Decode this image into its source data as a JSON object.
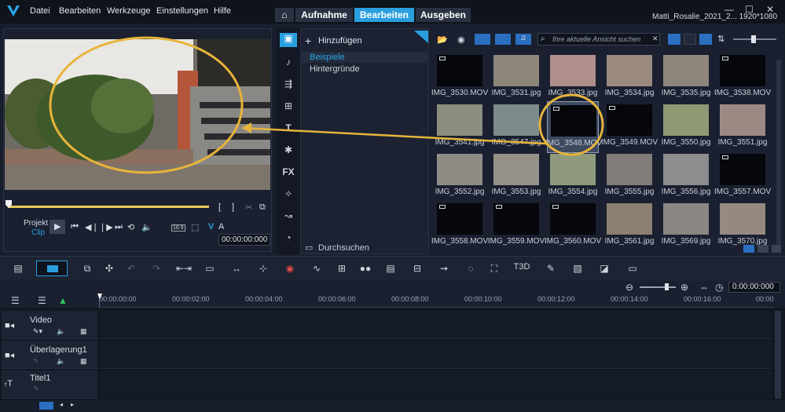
{
  "menu": [
    "Datei",
    "Bearbeiten",
    "Werkzeuge",
    "Einstellungen",
    "Hilfe"
  ],
  "tabs": {
    "aufnahme": "Aufnahme",
    "bearbeiten": "Bearbeiten",
    "ausgeben": "Ausgeben"
  },
  "project_title": "Matti_Rosalie_2021_2... 1920*1080",
  "window_controls": {
    "minimize": "—",
    "maximize": "☐",
    "close": "✕"
  },
  "preview": {
    "projekt": "Projekt",
    "clip": "Clip",
    "aspect": "16:9",
    "timecode": "00:00:00:000",
    "v_label": "V",
    "a_label": "A"
  },
  "library": {
    "add_label": "Hinzufügen",
    "categories": [
      "Beispiele",
      "Hintergründe"
    ],
    "browse": "Durchsuchen",
    "search_placeholder": "Ihre aktuelle Ansicht suchen",
    "fx": "FX",
    "thumbs": [
      {
        "name": "IMG_3530.MOV",
        "kind": "video",
        "color": "#05070b"
      },
      {
        "name": "IMG_3531.jpg",
        "kind": "image",
        "color": "#8d857a"
      },
      {
        "name": "IMG_3533.jpg",
        "kind": "image",
        "color": "#b08e8c"
      },
      {
        "name": "IMG_3534.jpg",
        "kind": "image",
        "color": "#9a8a7e"
      },
      {
        "name": "IMG_3535.jpg",
        "kind": "image",
        "color": "#8e867c"
      },
      {
        "name": "IMG_3538.MOV",
        "kind": "video",
        "color": "#05070b"
      },
      {
        "name": "IMG_3541.jpg",
        "kind": "image",
        "color": "#8a8f7e"
      },
      {
        "name": "IMG_3547.jpg",
        "kind": "image",
        "color": "#7d8c8a"
      },
      {
        "name": "IMG_3548.MOV",
        "kind": "video",
        "color": "#05070b"
      },
      {
        "name": "IMG_3549.MOV",
        "kind": "video",
        "color": "#05070b"
      },
      {
        "name": "IMG_3550.jpg",
        "kind": "image",
        "color": "#8e9a74"
      },
      {
        "name": "IMG_3551.jpg",
        "kind": "image",
        "color": "#9b8a84"
      },
      {
        "name": "IMG_3552.jpg",
        "kind": "image",
        "color": "#8f8c86"
      },
      {
        "name": "IMG_3553.jpg",
        "kind": "image",
        "color": "#979289"
      },
      {
        "name": "IMG_3554.jpg",
        "kind": "image",
        "color": "#8f9a7c"
      },
      {
        "name": "IMG_3555.jpg",
        "kind": "image",
        "color": "#817c7a"
      },
      {
        "name": "IMG_3556.jpg",
        "kind": "image",
        "color": "#8d8c8e"
      },
      {
        "name": "IMG_3557.MOV",
        "kind": "video",
        "color": "#05070b"
      },
      {
        "name": "IMG_3558.MOV",
        "kind": "video",
        "color": "#05070b"
      },
      {
        "name": "IMG_3559.MOV",
        "kind": "video",
        "color": "#05070b"
      },
      {
        "name": "IMG_3560.MOV",
        "kind": "video",
        "color": "#05070b"
      },
      {
        "name": "IMG_3561.jpg",
        "kind": "image",
        "color": "#8c8070"
      },
      {
        "name": "IMG_3569.jpg",
        "kind": "image",
        "color": "#8a8684"
      },
      {
        "name": "IMG_3570.jpg",
        "kind": "image",
        "color": "#948a80"
      }
    ]
  },
  "timeline": {
    "ticks": [
      "00:00:00:00",
      "00:00:02:00",
      "00:00:04:00",
      "00:00:06:00",
      "00:00:08:00",
      "00:00:10:00",
      "00:00:12:00",
      "00:00:14:00",
      "00:00:16:00",
      "00:00"
    ],
    "zoom_timecode": "0:00:00:000",
    "tracks": [
      "Video",
      "Überlagerung1",
      "Titel1"
    ],
    "fx_icon": "FX",
    "t3d": "T3D"
  },
  "accent": "#2a9fe0",
  "highlight": "#e7b43a"
}
